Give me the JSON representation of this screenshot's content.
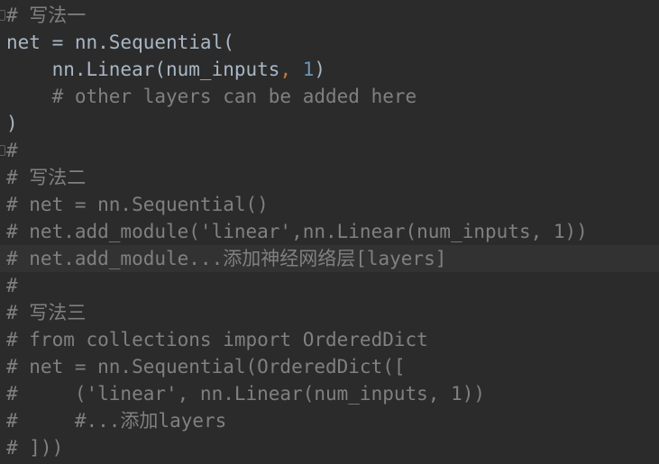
{
  "editor": {
    "lines": [
      {
        "parts": [
          {
            "text": "# 写法一",
            "class": "cm"
          }
        ],
        "fold": true
      },
      {
        "parts": [
          {
            "text": "net = nn.Sequential(",
            "class": "tx"
          }
        ]
      },
      {
        "parts": [
          {
            "text": "    nn.Linear(num_inputs",
            "class": "tx"
          },
          {
            "text": ",",
            "class": "punc"
          },
          {
            "text": " ",
            "class": "tx"
          },
          {
            "text": "1",
            "class": "num"
          },
          {
            "text": ")",
            "class": "tx"
          }
        ]
      },
      {
        "parts": [
          {
            "text": "    # other layers can be added here",
            "class": "cm"
          }
        ]
      },
      {
        "parts": [
          {
            "text": ")",
            "class": "tx"
          }
        ]
      },
      {
        "parts": [
          {
            "text": "#",
            "class": "cm"
          }
        ],
        "fold": true
      },
      {
        "parts": [
          {
            "text": "# 写法二",
            "class": "cm"
          }
        ]
      },
      {
        "parts": [
          {
            "text": "# net = nn.Sequential()",
            "class": "cm"
          }
        ]
      },
      {
        "parts": [
          {
            "text": "# net.add_module('linear',nn.Linear(num_inputs, 1))",
            "class": "cm"
          }
        ]
      },
      {
        "parts": [
          {
            "text": "# net.add_module...添加神经网络层[layers]",
            "class": "cm"
          }
        ],
        "current": true
      },
      {
        "parts": [
          {
            "text": "#",
            "class": "cm"
          }
        ]
      },
      {
        "parts": [
          {
            "text": "# 写法三",
            "class": "cm"
          }
        ]
      },
      {
        "parts": [
          {
            "text": "# from collections import OrderedDict",
            "class": "cm"
          }
        ]
      },
      {
        "parts": [
          {
            "text": "# net = nn.Sequential(OrderedDict([",
            "class": "cm"
          }
        ]
      },
      {
        "parts": [
          {
            "text": "#     ('linear', nn.Linear(num_inputs, 1))",
            "class": "cm"
          }
        ]
      },
      {
        "parts": [
          {
            "text": "#     #...添加layers",
            "class": "cm"
          }
        ]
      },
      {
        "parts": [
          {
            "text": "# ]))",
            "class": "cm"
          }
        ]
      }
    ]
  },
  "colors": {
    "background": "#2b2b2b",
    "current_line": "#323232",
    "default_text": "#a9b7c6",
    "comment": "#808080",
    "number": "#6897bb",
    "punctuation": "#cc7832"
  }
}
